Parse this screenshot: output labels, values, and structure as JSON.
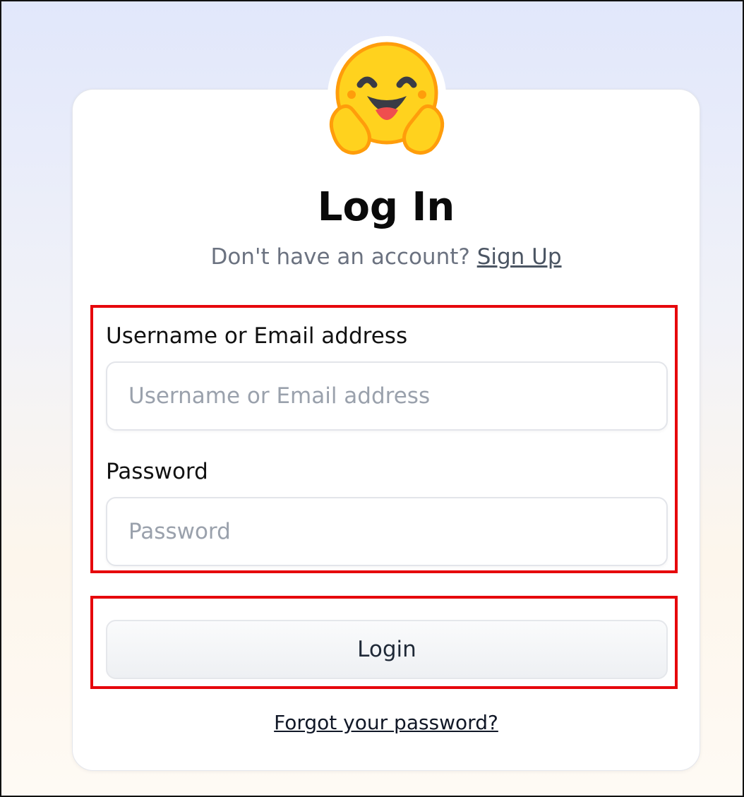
{
  "title": "Log In",
  "subtitle": {
    "prompt": "Don't have an account?",
    "signup_link": "Sign Up"
  },
  "form": {
    "username_label": "Username or Email address",
    "username_placeholder": "Username or Email address",
    "username_value": "",
    "password_label": "Password",
    "password_placeholder": "Password",
    "password_value": "",
    "login_button": "Login",
    "forgot_link": "Forgot your password?"
  },
  "logo": {
    "icon": "hugging-face-emoji-icon"
  },
  "colors": {
    "highlight": "#e6060c",
    "face": "#ffd21e",
    "face_outline": "#ff9d0b",
    "text_muted": "#6b7280"
  }
}
